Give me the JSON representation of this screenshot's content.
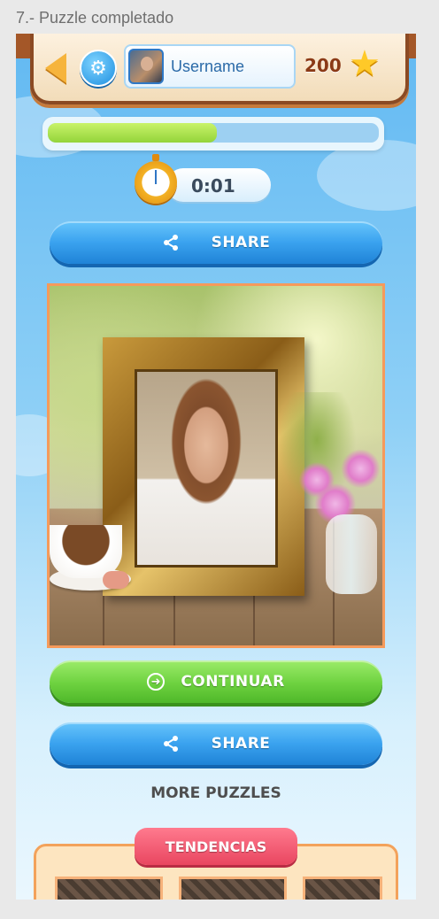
{
  "caption": "7.- Puzzle completado",
  "header": {
    "back_icon": "back-arrow-icon",
    "settings_icon": "gear-icon",
    "username": "Username",
    "score": "200",
    "score_icon": "star-icon"
  },
  "progress": {
    "value": 0.51,
    "fill_color": "#b4e457"
  },
  "timer": {
    "value": "0:01",
    "icon": "stopwatch-icon"
  },
  "buttons": {
    "share_top": "SHARE",
    "continue": "CONTINUAR",
    "share_bottom": "SHARE",
    "more_puzzles": "MORE PUZZLES"
  },
  "trending": {
    "label": "TENDENCIAS"
  },
  "colors": {
    "blue_button": "#3aa2ef",
    "green_button": "#6dd13f",
    "trend_tag": "#e94660",
    "puzzle_border": "#f59a5b"
  }
}
